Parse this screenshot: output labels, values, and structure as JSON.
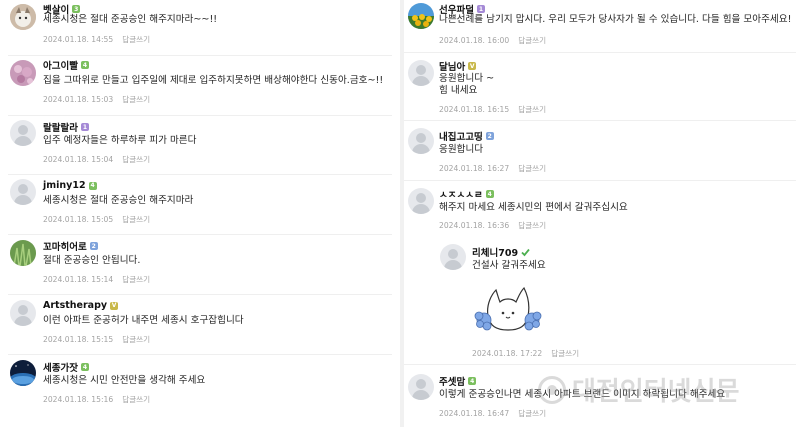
{
  "colors": {
    "level_green": "#7bbf5e",
    "level_purple": "#a58ad6",
    "level_blue": "#7fa3db",
    "level_yellow": "#c8b84a",
    "meta_gray": "#a3a3a3"
  },
  "left_comments": [
    {
      "nick": "벳살이",
      "level": "3",
      "level_color": "#7bbf5e",
      "avatar": "cat-photo-avatar",
      "text": "세종시청은 절대 준공승인 해주지마라~~!!",
      "date": "2024.01.18. 14:55",
      "reply": "답글쓰기"
    },
    {
      "nick": "아그이빨",
      "level": "4",
      "level_color": "#7bbf5e",
      "avatar": "flower-photo-avatar",
      "text": "집을 그따위로 만들고 입주일에 제대로 입주하지못하면 배상해야한다 신동아.금호~!!",
      "date": "2024.01.18. 15:03",
      "reply": "답글쓰기"
    },
    {
      "nick": "랄랄랄라",
      "level": "1",
      "level_color": "#a58ad6",
      "avatar": "default-user-avatar",
      "text": "입주 예정자들은 하루하루 피가 마른다",
      "date": "2024.01.18. 15:04",
      "reply": "답글쓰기"
    },
    {
      "nick": "jminy12",
      "level": "4",
      "level_color": "#7bbf5e",
      "avatar": "default-user-avatar",
      "text": "세종시청은 절대 준공승인 해주지마라",
      "date": "2024.01.18. 15:05",
      "reply": "답글쓰기"
    },
    {
      "nick": "꼬마히어로",
      "level": "2",
      "level_color": "#7fa3db",
      "avatar": "grass-photo-avatar",
      "text": "절대 준공승인 안됩니다.",
      "date": "2024.01.18. 15:14",
      "reply": "답글쓰기"
    },
    {
      "nick": "Artstherapy",
      "level": "V",
      "level_color": "#c8b84a",
      "avatar": "default-user-avatar",
      "text": "이런 아파트 준공허가 내주면 세종시 호구잡힙니다",
      "date": "2024.01.18. 15:15",
      "reply": "답글쓰기"
    },
    {
      "nick": "세종가잣",
      "level": "4",
      "level_color": "#7bbf5e",
      "avatar": "earth-photo-avatar",
      "text": "세종시청은 시민 안전만을 생각해 주세요",
      "date": "2024.01.18. 15:16",
      "reply": "답글쓰기"
    }
  ],
  "right_comments": [
    {
      "nick": "선우파덜",
      "level": "1",
      "level_color": "#a58ad6",
      "avatar": "sunflower-photo-avatar",
      "text": "나쁜선례를 남기지 맙시다. 우리 모두가 당사자가 될 수 있습니다. 다들 힘을 모아주세요!",
      "date": "2024.01.18. 16:00",
      "reply": "답글쓰기"
    },
    {
      "nick": "달님아",
      "level": "V",
      "level_color": "#c8b84a",
      "avatar": "default-user-avatar",
      "text": "응원합니다 ~",
      "text2": "힘 내세요",
      "date": "2024.01.18. 16:15",
      "reply": "답글쓰기"
    },
    {
      "nick": "내집고고띵",
      "level": "2",
      "level_color": "#7fa3db",
      "avatar": "default-user-avatar",
      "text": "응원합니다",
      "date": "2024.01.18. 16:27",
      "reply": "답글쓰기"
    },
    {
      "nick": "ㅅㅈㅅㅅㄹ",
      "level": "4",
      "level_color": "#7bbf5e",
      "avatar": "default-user-avatar",
      "text": "해주지 마세요 세종시민의 편에서 갈궈주십시요",
      "date": "2024.01.18. 16:36",
      "reply": "답글쓰기"
    },
    {
      "nick": "주셋맘",
      "level": "4",
      "level_color": "#7bbf5e",
      "avatar": "default-user-avatar",
      "text": "이렇게 준공승인나면 세종시 아파트 브랜드 이미지 하락됩니다 해주세요",
      "date": "2024.01.18. 16:47",
      "reply": "답글쓰기"
    }
  ],
  "reply_comment": {
    "nick": "리체니709",
    "level_icon": "check-mark-icon",
    "level_color": "#4caf50",
    "avatar": "default-user-avatar",
    "text": "건설사 갈궈주세요",
    "sticker": "cheering-bunny-sticker",
    "date": "2024.01.18. 17:22",
    "reply": "답글쓰기"
  },
  "watermark": {
    "text": "대전인터넷신문"
  }
}
